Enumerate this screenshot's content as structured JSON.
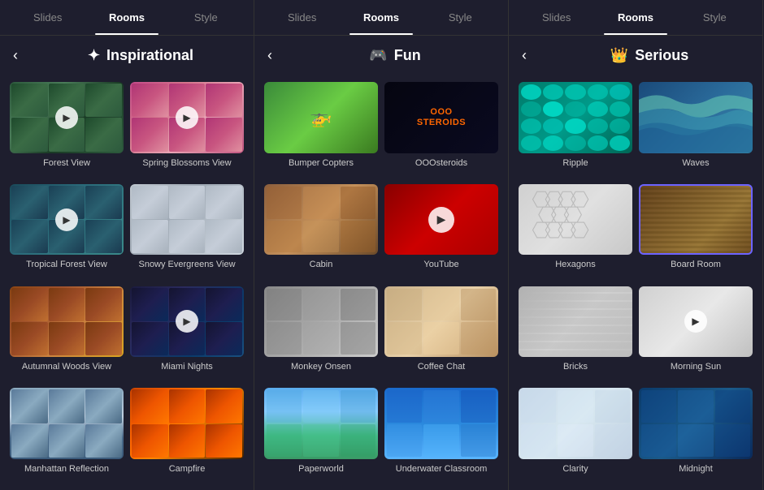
{
  "panels": [
    {
      "tabs": [
        "Slides",
        "Rooms",
        "Style"
      ],
      "active_tab": "Rooms",
      "header": {
        "icon": "✦",
        "title": "Inspirational"
      },
      "rooms": [
        {
          "id": "forest-view",
          "label": "Forest View",
          "thumb": "forest",
          "has_play": true
        },
        {
          "id": "spring-blossoms",
          "label": "Spring Blossoms View",
          "thumb": "spring",
          "has_play": true
        },
        {
          "id": "tropical-forest",
          "label": "Tropical Forest View",
          "thumb": "tropical",
          "has_play": true
        },
        {
          "id": "snowy-evergreens",
          "label": "Snowy Evergreens View",
          "thumb": "snowy",
          "has_play": false
        },
        {
          "id": "autumnal-woods",
          "label": "Autumnal Woods View",
          "thumb": "autumnal",
          "has_play": false
        },
        {
          "id": "miami-nights",
          "label": "Miami Nights",
          "thumb": "miami",
          "has_play": true
        },
        {
          "id": "manhattan",
          "label": "Manhattan Reflection",
          "thumb": "manhattan",
          "has_play": false
        },
        {
          "id": "campfire",
          "label": "Campfire",
          "thumb": "campfire",
          "has_play": false
        }
      ]
    },
    {
      "tabs": [
        "Slides",
        "Rooms",
        "Style"
      ],
      "active_tab": "Rooms",
      "header": {
        "icon": "🎮",
        "title": "Fun"
      },
      "rooms": [
        {
          "id": "bumper-copters",
          "label": "Bumper Copters",
          "thumb": "bumper",
          "has_play": false
        },
        {
          "id": "ooo-steroids",
          "label": "OOOsteroids",
          "thumb": "ooo",
          "has_play": false
        },
        {
          "id": "cabin",
          "label": "Cabin",
          "thumb": "cabin",
          "has_play": false
        },
        {
          "id": "youtube",
          "label": "YouTube",
          "thumb": "youtube",
          "has_play": true
        },
        {
          "id": "monkey-onsen",
          "label": "Monkey Onsen",
          "thumb": "monkey",
          "has_play": false
        },
        {
          "id": "coffee-chat",
          "label": "Coffee Chat",
          "thumb": "coffee",
          "has_play": false
        },
        {
          "id": "paperworld",
          "label": "Paperworld",
          "thumb": "paperworld",
          "has_play": false
        },
        {
          "id": "underwater",
          "label": "Underwater Classroom",
          "thumb": "underwater",
          "has_play": false
        }
      ]
    },
    {
      "tabs": [
        "Slides",
        "Rooms",
        "Style"
      ],
      "active_tab": "Rooms",
      "header": {
        "icon": "👑",
        "title": "Serious"
      },
      "rooms": [
        {
          "id": "ripple",
          "label": "Ripple",
          "thumb": "ripple",
          "has_play": false
        },
        {
          "id": "waves",
          "label": "Waves",
          "thumb": "waves",
          "has_play": false
        },
        {
          "id": "hexagons",
          "label": "Hexagons",
          "thumb": "hexagons",
          "has_play": false
        },
        {
          "id": "board-room",
          "label": "Board Room",
          "thumb": "boardroom",
          "has_play": false,
          "selected": true
        },
        {
          "id": "bricks",
          "label": "Bricks",
          "thumb": "bricks",
          "has_play": false
        },
        {
          "id": "morning-sun",
          "label": "Morning Sun",
          "thumb": "morningsun",
          "has_play": true
        },
        {
          "id": "clarity",
          "label": "Clarity",
          "thumb": "clarity",
          "has_play": false
        },
        {
          "id": "midnight",
          "label": "Midnight",
          "thumb": "midnight",
          "has_play": false
        }
      ]
    }
  ],
  "back_label": "‹",
  "play_symbol": "▶"
}
